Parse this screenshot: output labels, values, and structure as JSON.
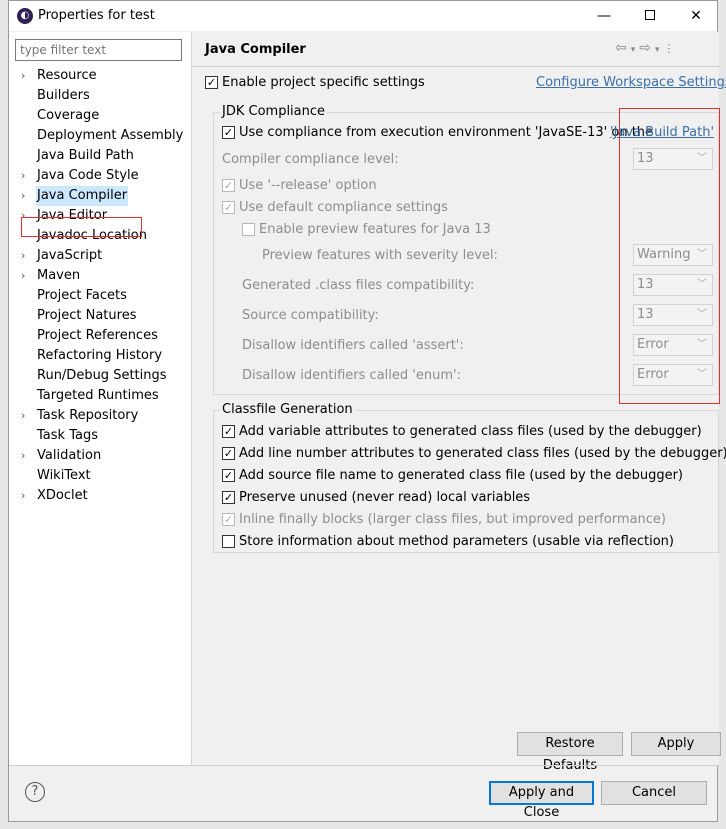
{
  "window": {
    "title": "Properties for test",
    "minimize": "—",
    "close": "✕"
  },
  "filter": {
    "placeholder": "type filter text"
  },
  "tree": [
    {
      "label": "Resource",
      "expandable": true
    },
    {
      "label": "Builders",
      "expandable": false
    },
    {
      "label": "Coverage",
      "expandable": false
    },
    {
      "label": "Deployment Assembly",
      "expandable": false
    },
    {
      "label": "Java Build Path",
      "expandable": false
    },
    {
      "label": "Java Code Style",
      "expandable": true
    },
    {
      "label": "Java Compiler",
      "expandable": true
    },
    {
      "label": "Java Editor",
      "expandable": true
    },
    {
      "label": "Javadoc Location",
      "expandable": false
    },
    {
      "label": "JavaScript",
      "expandable": true
    },
    {
      "label": "Maven",
      "expandable": true
    },
    {
      "label": "Project Facets",
      "expandable": false
    },
    {
      "label": "Project Natures",
      "expandable": false
    },
    {
      "label": "Project References",
      "expandable": false
    },
    {
      "label": "Refactoring History",
      "expandable": false
    },
    {
      "label": "Run/Debug Settings",
      "expandable": false
    },
    {
      "label": "Targeted Runtimes",
      "expandable": false
    },
    {
      "label": "Task Repository",
      "expandable": true
    },
    {
      "label": "Task Tags",
      "expandable": false
    },
    {
      "label": "Validation",
      "expandable": true
    },
    {
      "label": "WikiText",
      "expandable": false
    },
    {
      "label": "XDoclet",
      "expandable": true
    }
  ],
  "page": {
    "header": "Java Compiler",
    "enable_specific": {
      "label": "Enable project specific settings",
      "checked": true
    },
    "configure_link": "Configure Workspace Settings...",
    "jdk": {
      "title": "JDK Compliance",
      "use_env_label": "Use compliance from execution environment 'JavaSE-13' on the ",
      "build_path_link": "'Java Build Path'",
      "compliance_level_label": "Compiler compliance level:",
      "compliance_level_value": "13",
      "release_option": "Use '--release' option",
      "default_compliance": "Use default compliance settings",
      "preview": "Enable preview features for Java 13",
      "preview_severity_label": "Preview features with severity level:",
      "preview_severity_value": "Warning",
      "class_compat_label": "Generated .class files compatibility:",
      "class_compat_value": "13",
      "source_compat_label": "Source compatibility:",
      "source_compat_value": "13",
      "assert_label": "Disallow identifiers called 'assert':",
      "assert_value": "Error",
      "enum_label": "Disallow identifiers called 'enum':",
      "enum_value": "Error"
    },
    "classfile": {
      "title": "Classfile Generation",
      "var_attrs": "Add variable attributes to generated class files (used by the debugger)",
      "line_attrs": "Add line number attributes to generated class files (used by the debugger)",
      "source_name": "Add source file name to generated class file (used by the debugger)",
      "preserve": "Preserve unused (never read) local variables",
      "inline_finally": "Inline finally blocks (larger class files, but improved performance)",
      "store_params": "Store information about method parameters (usable via reflection)"
    },
    "restore_defaults": "Restore Defaults",
    "apply": "Apply"
  },
  "footer": {
    "help": "?",
    "apply_close": "Apply and Close",
    "cancel": "Cancel"
  }
}
